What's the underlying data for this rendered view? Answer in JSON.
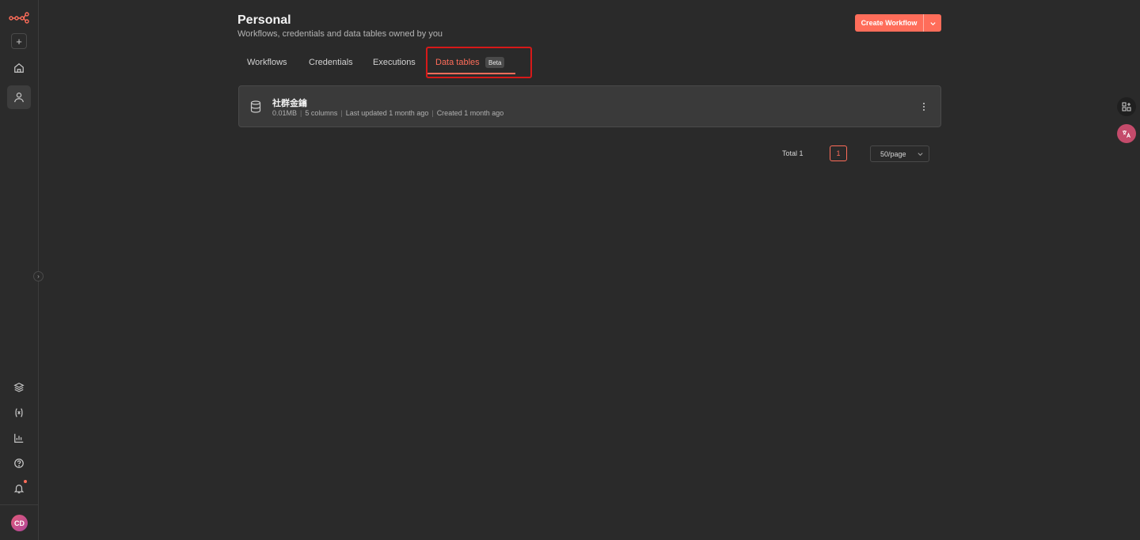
{
  "header": {
    "title": "Personal",
    "subtitle": "Workflows, credentials and data tables owned by you",
    "create_label": "Create Workflow"
  },
  "tabs": [
    {
      "label": "Workflows"
    },
    {
      "label": "Credentials"
    },
    {
      "label": "Executions"
    },
    {
      "label": "Data tables",
      "badge": "Beta",
      "active": true
    }
  ],
  "data_tables": [
    {
      "name": "社群金鑰",
      "size": "0.01MB",
      "columns": "5 columns",
      "updated": "Last updated 1 month ago",
      "created": "Created 1 month ago"
    }
  ],
  "pagination": {
    "total": "Total 1",
    "current_page": "1",
    "page_size": "50/page"
  },
  "sidebar": {
    "avatar_initials": "CD",
    "items": [
      "home-icon",
      "user-icon",
      "templates-icon",
      "variables-icon",
      "insights-icon",
      "help-icon",
      "bell-icon"
    ]
  },
  "colors": {
    "accent": "#ff6d5a",
    "highlight": "#d71919",
    "background": "#2a2a2a"
  }
}
